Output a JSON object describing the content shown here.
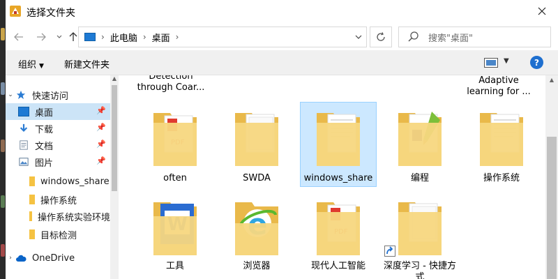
{
  "window": {
    "title": "选择文件夹"
  },
  "nav": {
    "breadcrumb": [
      "此电脑",
      "桌面"
    ],
    "search_placeholder": "搜索\"桌面\""
  },
  "toolbar": {
    "organize_label": "组织",
    "new_folder_label": "新建文件夹"
  },
  "sidebar": {
    "items": [
      {
        "label": "快速访问",
        "icon": "star-icon"
      },
      {
        "label": "桌面",
        "icon": "desktop-icon",
        "pinned": true,
        "selected": true
      },
      {
        "label": "下载",
        "icon": "download-icon",
        "pinned": true
      },
      {
        "label": "文档",
        "icon": "document-icon",
        "pinned": true
      },
      {
        "label": "图片",
        "icon": "picture-icon",
        "pinned": true
      },
      {
        "label": "windows_share",
        "icon": "folder-icon"
      },
      {
        "label": "操作系统",
        "icon": "folder-icon"
      },
      {
        "label": "操作系统实验环境",
        "icon": "folder-icon"
      },
      {
        "label": "目标检测",
        "icon": "folder-icon"
      },
      {
        "label": "OneDrive",
        "icon": "cloud-icon"
      }
    ]
  },
  "files": {
    "partial_top": [
      {
        "label": "Detection through Coar..."
      },
      {
        "label": "Adaptive learning for ..."
      }
    ],
    "items": [
      {
        "label": "often",
        "overlay": "pdf-icon"
      },
      {
        "label": "SWDA",
        "overlay": "pages-icon"
      },
      {
        "label": "windows_share",
        "overlay": "document-icon",
        "selected": true
      },
      {
        "label": "编程",
        "overlay": "pen-icon"
      },
      {
        "label": "操作系统",
        "overlay": "document-icon"
      },
      {
        "label": "工具",
        "overlay": "wps-writer-icon"
      },
      {
        "label": "浏览器",
        "overlay": "ie-browser-icon"
      },
      {
        "label": "现代人工智能",
        "overlay": "pdf-icon"
      },
      {
        "label": "深度学习 - 快捷方式",
        "overlay": "pages-icon",
        "shortcut": true
      }
    ]
  },
  "colors": {
    "accent": "#1e6fcf",
    "selection": "#cce8ff",
    "folder": "#f5d37b"
  }
}
